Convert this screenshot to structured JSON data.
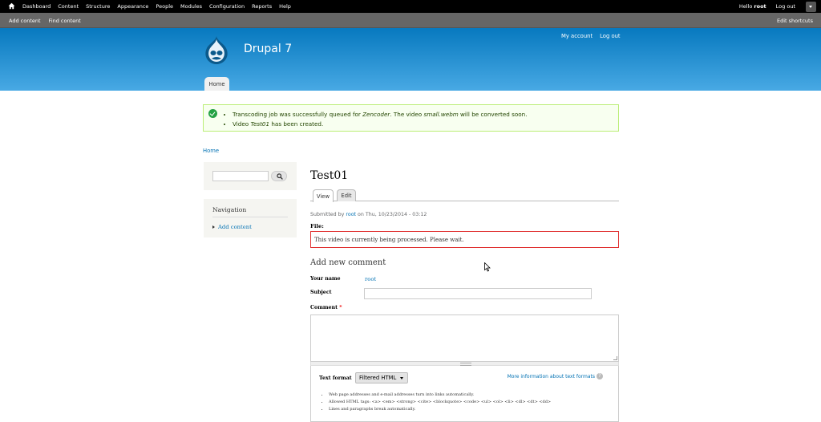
{
  "toolbar": {
    "menu": [
      "Dashboard",
      "Content",
      "Structure",
      "Appearance",
      "People",
      "Modules",
      "Configuration",
      "Reports",
      "Help"
    ],
    "hello_prefix": "Hello ",
    "user": "root",
    "logout": "Log out",
    "shortcuts": [
      "Add content",
      "Find content"
    ],
    "edit_shortcuts": "Edit shortcuts"
  },
  "header": {
    "site_name": "Drupal 7",
    "secondary_menu": [
      "My account",
      "Log out"
    ],
    "main_tab": "Home"
  },
  "messages": {
    "line1_pre": "Transcoding job was successfully queued for ",
    "line1_service": "Zencoder",
    "line1_mid": ". The video ",
    "line1_file": "small.webm",
    "line1_post": " will be converted soon.",
    "line2_pre": "Video ",
    "line2_title": "Test01",
    "line2_post": " has been created."
  },
  "breadcrumb": "Home",
  "sidebar": {
    "navigation_title": "Navigation",
    "nav_items": [
      "Add content"
    ]
  },
  "node": {
    "title": "Test01",
    "tabs": [
      "View",
      "Edit"
    ],
    "submitted_pre": "Submitted by ",
    "submitted_user": "root",
    "submitted_post": " on Thu, 10/23/2014 - 03:12",
    "file_label": "File:",
    "processing_message": "This video is currently being processed. Please wait."
  },
  "comment_form": {
    "title": "Add new comment",
    "your_name_label": "Your name",
    "your_name_value": "root",
    "subject_label": "Subject",
    "comment_label": "Comment",
    "required_mark": "*",
    "text_format_label": "Text format",
    "text_format_value": "Filtered HTML",
    "more_info_link": "More information about text formats",
    "help_icon_text": "?",
    "format_tips": [
      "Web page addresses and e-mail addresses turn into links automatically.",
      "Allowed HTML tags: <a> <em> <strong> <cite> <blockquote> <code> <ul> <ol> <li> <dl> <dt> <dd>",
      "Lines and paragraphs break automatically."
    ]
  },
  "icons": [
    "home-icon",
    "toolbar-toggle-icon",
    "drupal-logo",
    "checkmark-icon",
    "search-icon",
    "help-icon",
    "mouse-cursor-icon"
  ]
}
